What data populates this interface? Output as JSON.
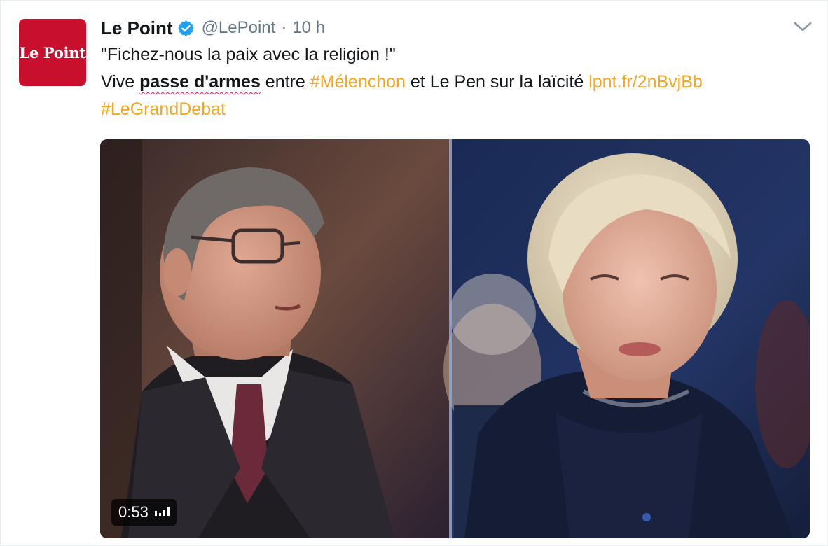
{
  "tweet": {
    "avatar_text": "Le Point",
    "fullname": "Le Point",
    "username": "@LePoint",
    "separator": "·",
    "time": "10 h",
    "text": {
      "quote": "\"Fichez-nous la paix avec la religion !\"",
      "part_vive": "Vive ",
      "strong": "passe d'armes",
      "part_entre": " entre ",
      "hashtag_melenchon": "#Mélenchon",
      "part_lepen": " et Le Pen sur la laïcité ",
      "url": "lpnt.fr/2nBvjBb",
      "hashtag_debat": "#LeGrandDebat"
    },
    "media": {
      "duration": "0:53",
      "stats_icon": "bar-chart-icon"
    }
  },
  "colors": {
    "brand_red": "#c8102e",
    "link": "#f5a623",
    "verified": "#1da1f2",
    "text": "#14171a",
    "secondary": "#657786"
  }
}
